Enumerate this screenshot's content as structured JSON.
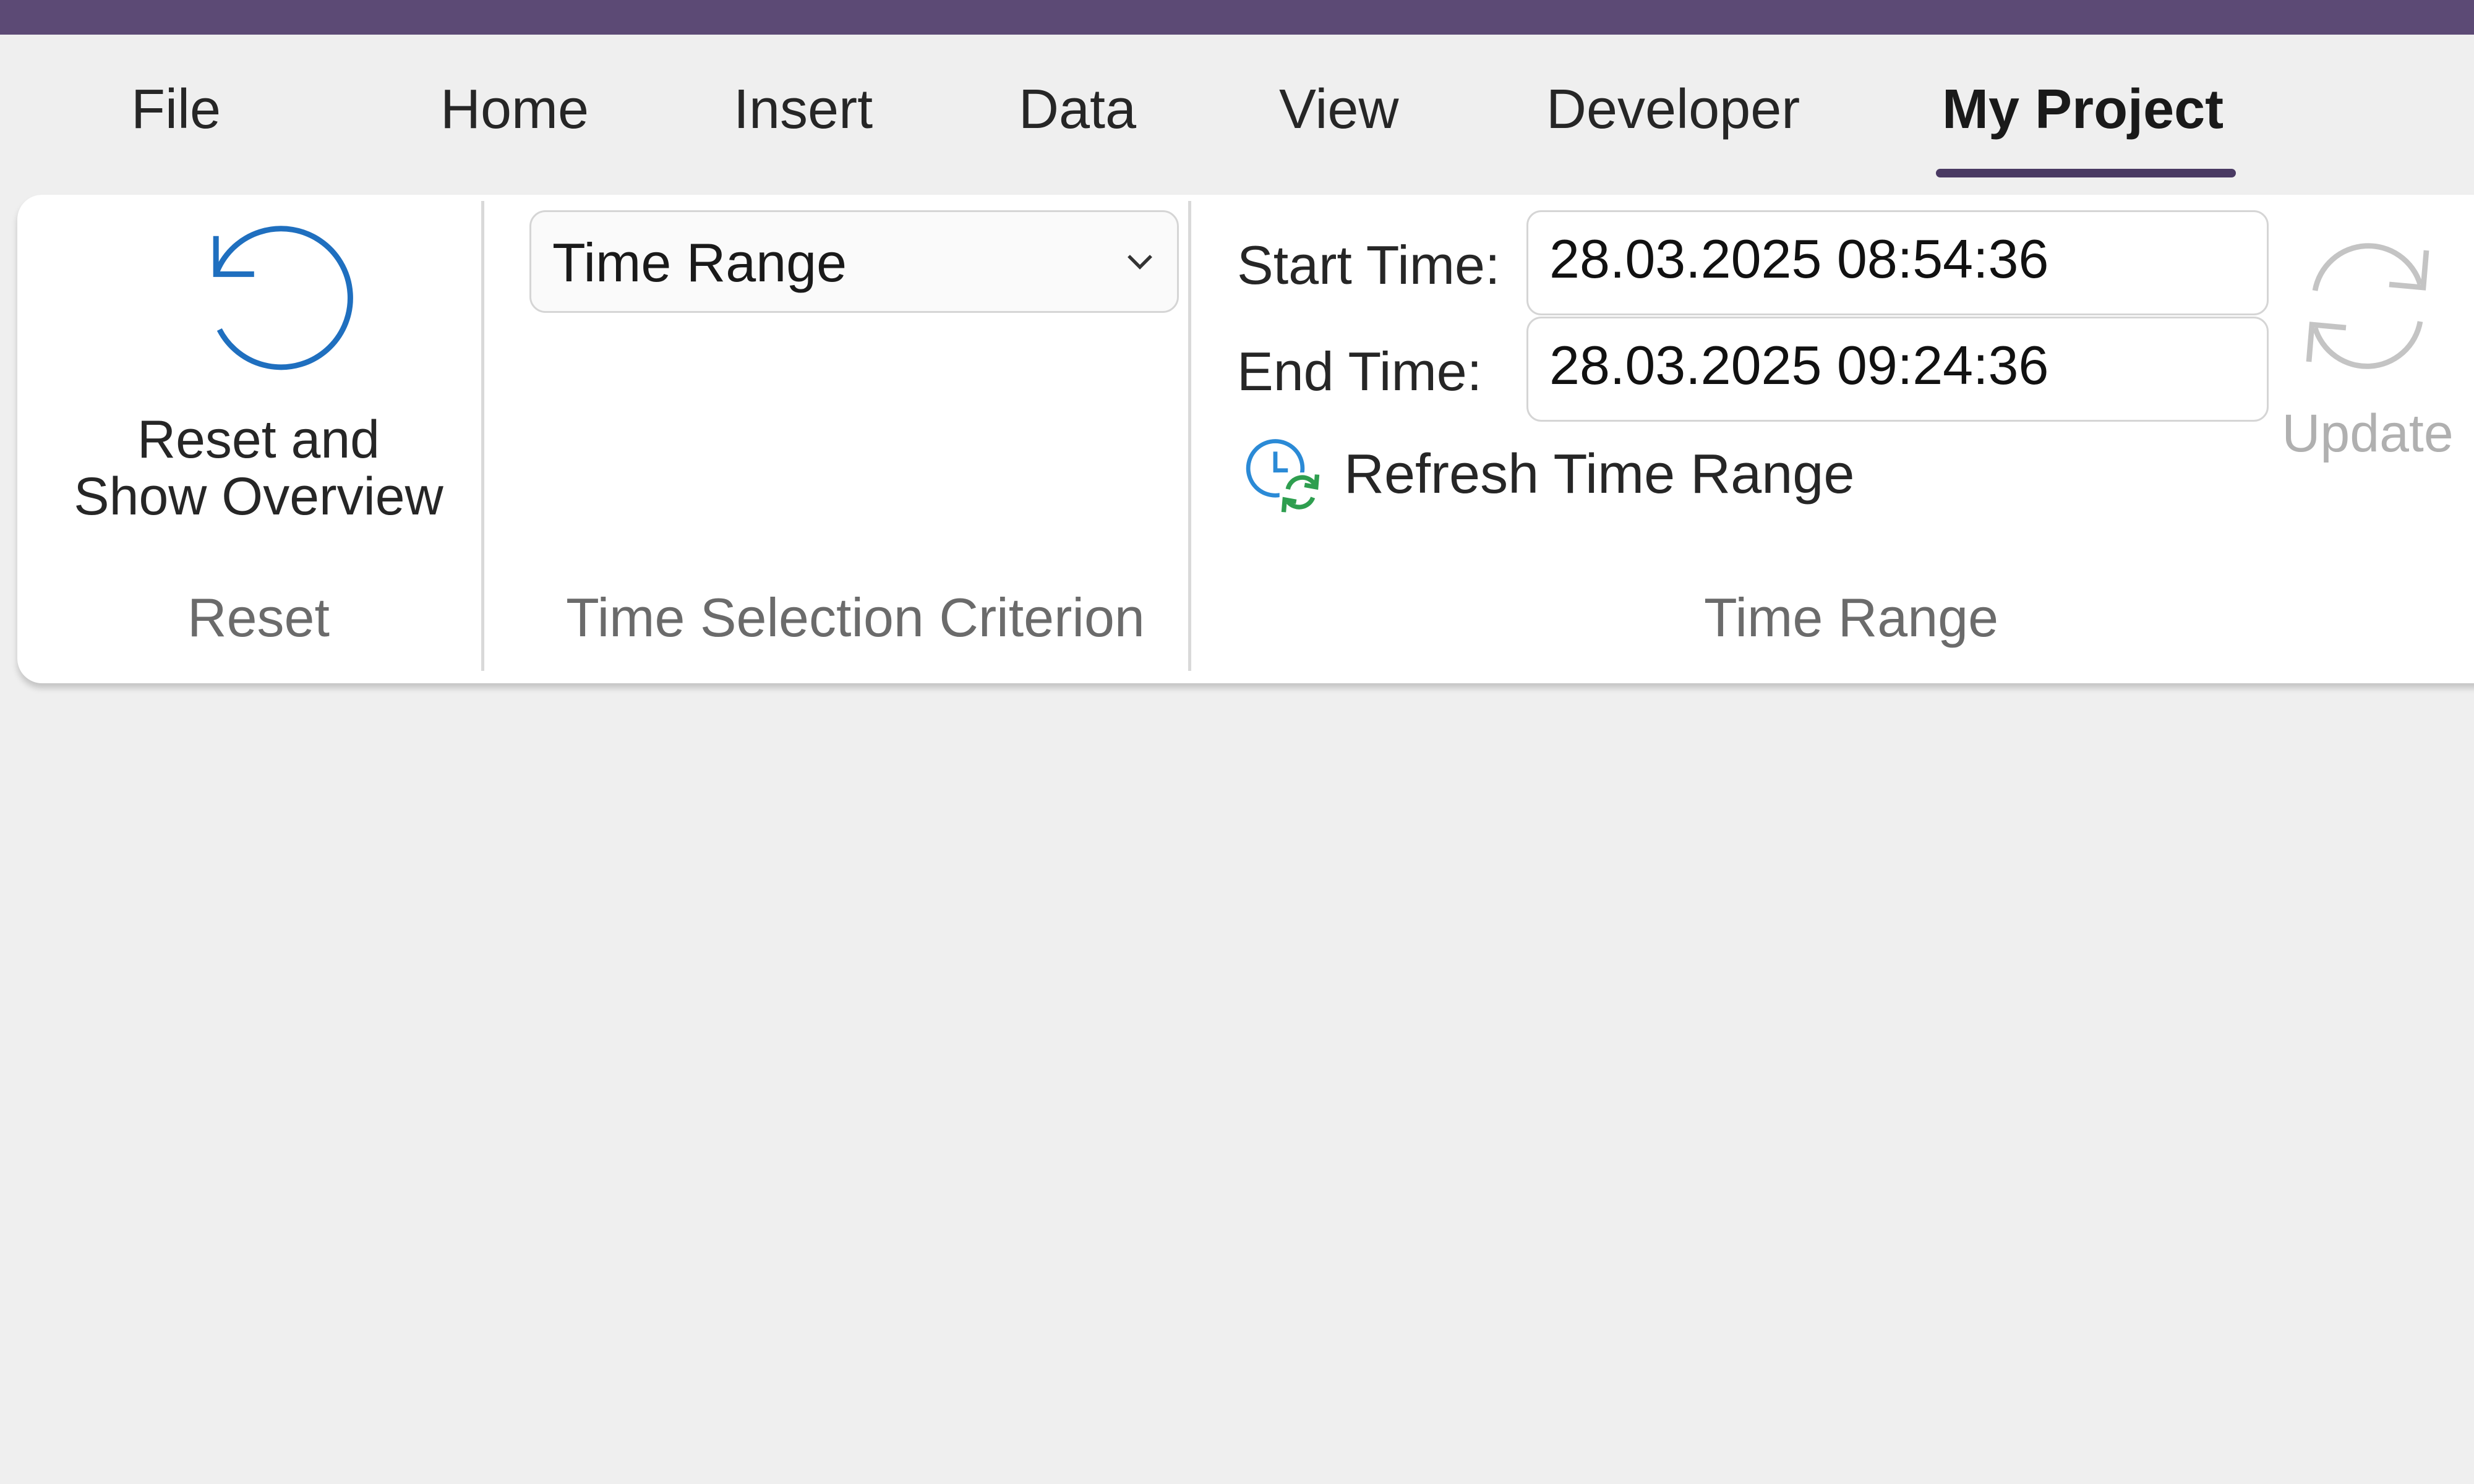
{
  "tabs": [
    {
      "label": "File"
    },
    {
      "label": "Home"
    },
    {
      "label": "Insert"
    },
    {
      "label": "Data"
    },
    {
      "label": "View"
    },
    {
      "label": "Developer"
    },
    {
      "label": "My Project",
      "active": true
    }
  ],
  "ribbon": {
    "reset_group": {
      "button_line1": "Reset and",
      "button_line2": "Show Overview",
      "button_icon": "reset-icon",
      "label": "Reset"
    },
    "criterion_group": {
      "selected": "Time Range",
      "label": "Time Selection Criterion"
    },
    "time_range_group": {
      "start_label": "Start Time:",
      "start_value": "28.03.2025 08:54:36",
      "end_label": "End Time:",
      "end_value": "28.03.2025 09:24:36",
      "refresh_label": "Refresh Time Range",
      "refresh_icon": "clock-refresh-icon",
      "update_label": "Update",
      "update_icon": "refresh-icon",
      "label": "Time Range"
    }
  },
  "colors": {
    "titlebar": "#5c4a75",
    "accent": "#4a3a63",
    "reset_icon": "#1f6fbf",
    "clock_icon": "#2b8ad6",
    "refresh_arrows": "#2e9e4f",
    "disabled": "#b0b0b0"
  }
}
